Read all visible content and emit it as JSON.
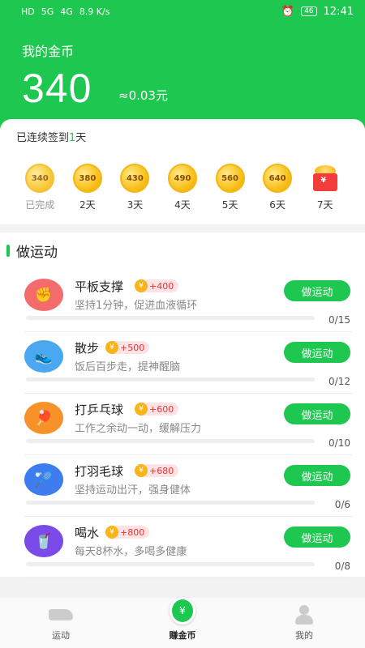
{
  "status_bar": {
    "left_items": [
      "HD",
      "5G",
      "4G",
      "8.9 K/s"
    ],
    "time": "12:41",
    "battery": "46"
  },
  "header": {
    "title": "我的金币",
    "coins": "340",
    "yuan": "≈0.03元"
  },
  "checkin": {
    "prefix": "已连续签到",
    "days": "1",
    "suffix": "天",
    "items": [
      {
        "coins": "340",
        "label": "已完成",
        "done": true
      },
      {
        "coins": "380",
        "label": "2天"
      },
      {
        "coins": "430",
        "label": "3天"
      },
      {
        "coins": "490",
        "label": "4天"
      },
      {
        "coins": "560",
        "label": "5天"
      },
      {
        "coins": "640",
        "label": "6天"
      },
      {
        "coins": "",
        "label": "7天",
        "icon": "gift-icon"
      }
    ]
  },
  "tasks": {
    "title": "做运动",
    "button_label": "做运动",
    "items": [
      {
        "name": "平板支撑",
        "reward": "+400",
        "desc": "坚持1分钟，促进血液循环",
        "progress": "0/15",
        "icon": "plank-fist-icon",
        "icon_color": "#f36b6b"
      },
      {
        "name": "散步",
        "reward": "+500",
        "desc": "饭后百步走，提神醒脑",
        "progress": "0/12",
        "icon": "sneaker-icon",
        "icon_color": "#4aa8f0"
      },
      {
        "name": "打乒乓球",
        "reward": "+600",
        "desc": "工作之余动一动，缓解压力",
        "progress": "0/10",
        "icon": "ping-pong-icon",
        "icon_color": "#f7922a"
      },
      {
        "name": "打羽毛球",
        "reward": "+680",
        "desc": "坚持运动出汗，强身健体",
        "progress": "0/6",
        "icon": "shuttlecock-icon",
        "icon_color": "#3d7df0"
      },
      {
        "name": "喝水",
        "reward": "+800",
        "desc": "每天8杯水，多喝多健康",
        "progress": "0/8",
        "icon": "water-cup-icon",
        "icon_color": "#7a4be8"
      }
    ]
  },
  "tabbar": {
    "items": [
      {
        "label": "运动",
        "icon": "sneaker-icon"
      },
      {
        "label": "赚金币",
        "icon": "yen-coin-icon",
        "active": true
      },
      {
        "label": "我的",
        "icon": "person-icon"
      }
    ]
  },
  "colors": {
    "accent": "#1ec74f",
    "reward": "#e33333",
    "coin": "#f8c21c"
  }
}
